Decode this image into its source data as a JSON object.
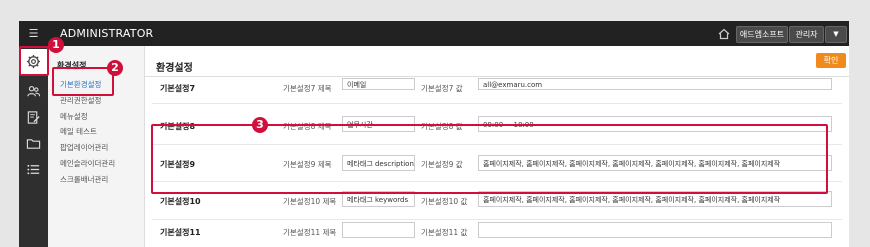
{
  "topbar": {
    "brand": "ADMINISTRATOR",
    "menu_icon": "☰",
    "company_button": "애드엠소프트",
    "admin_button": "관리자",
    "caret": "▼"
  },
  "iconbar": {
    "items": [
      {
        "icon": "gear-icon",
        "active": true
      },
      {
        "icon": "users-icon",
        "active": false
      },
      {
        "icon": "edit-document-icon",
        "active": false
      },
      {
        "icon": "folder-icon",
        "active": false
      },
      {
        "icon": "list-icon",
        "active": false
      }
    ]
  },
  "subnav": {
    "title": "환경설정",
    "items": [
      "기본환경설정",
      "관리권한설정",
      "메뉴설정",
      "메일 테스트",
      "팝업레이어관리",
      "메인슬라이더관리",
      "스크롤배너관리"
    ],
    "active_index": 0
  },
  "main": {
    "title": "환경설정",
    "confirm_button": "확인",
    "rows": [
      {
        "label": "기본설정7",
        "title_label": "기본설정7 제목",
        "title_value": "이메일",
        "value_label": "기본설정7 값",
        "value": "all@exmaru.com"
      },
      {
        "label": "기본설정8",
        "title_label": "기본설정8 제목",
        "title_value": "업무시간",
        "value_label": "기본설정8 값",
        "value": "09:00 ~ 18:00"
      },
      {
        "label": "기본설정9",
        "title_label": "기본설정9 제목",
        "title_value": "메타태그 description",
        "value_label": "기본설정9 값",
        "value": "홈페이지제작, 홈페이지제작, 홈페이지제작, 홈페이지제작, 홈페이지제작, 홈페이지제작, 홈페이지제작"
      },
      {
        "label": "기본설정10",
        "title_label": "기본설정10 제목",
        "title_value": "메타태그 keywords",
        "value_label": "기본설정10 값",
        "value": "홈페이지제작, 홈페이지제작, 홈페이지제작, 홈페이지제작, 홈페이지제작, 홈페이지제작, 홈페이지제작"
      },
      {
        "label": "기본설정11",
        "title_label": "기본설정11 제목",
        "title_value": "",
        "value_label": "기본설정11 값",
        "value": ""
      }
    ]
  },
  "callouts": [
    "1",
    "2",
    "3"
  ],
  "colors": {
    "accent": "#d0103a",
    "confirm": "#f08a1c",
    "link": "#2a72c7"
  }
}
